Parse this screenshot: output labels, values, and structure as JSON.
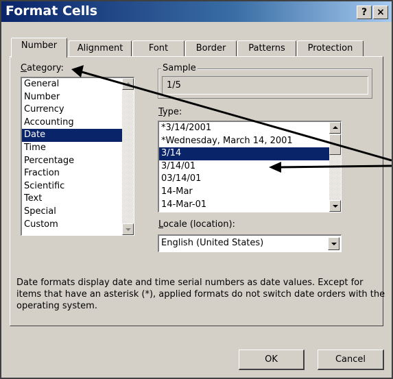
{
  "window": {
    "title": "Format Cells",
    "help_button": "?",
    "close_button": "×"
  },
  "tabs": [
    {
      "label": "Number",
      "active": true
    },
    {
      "label": "Alignment"
    },
    {
      "label": "Font"
    },
    {
      "label": "Border"
    },
    {
      "label": "Patterns"
    },
    {
      "label": "Protection"
    }
  ],
  "category": {
    "label_access": "C",
    "label_rest": "ategory:",
    "items": [
      "General",
      "Number",
      "Currency",
      "Accounting",
      "Date",
      "Time",
      "Percentage",
      "Fraction",
      "Scientific",
      "Text",
      "Special",
      "Custom"
    ],
    "selected": "Date"
  },
  "sample": {
    "label": "Sample",
    "value": "1/5"
  },
  "type": {
    "label_access": "T",
    "label_rest": "ype:",
    "items": [
      "*3/14/2001",
      "*Wednesday, March 14, 2001",
      "3/14",
      "3/14/01",
      "03/14/01",
      "14-Mar",
      "14-Mar-01"
    ],
    "selected": "3/14"
  },
  "locale": {
    "label_access": "L",
    "label_rest": "ocale (location):",
    "value": "English (United States)"
  },
  "description": "Date formats display date and time serial numbers as date values. Except for items that have an asterisk (*), applied formats do not switch date orders with the operating system.",
  "buttons": {
    "ok": "OK",
    "cancel": "Cancel"
  },
  "colors": {
    "title_bar": "#0a246a",
    "selection": "#0a246a",
    "face": "#d4d0c8"
  }
}
